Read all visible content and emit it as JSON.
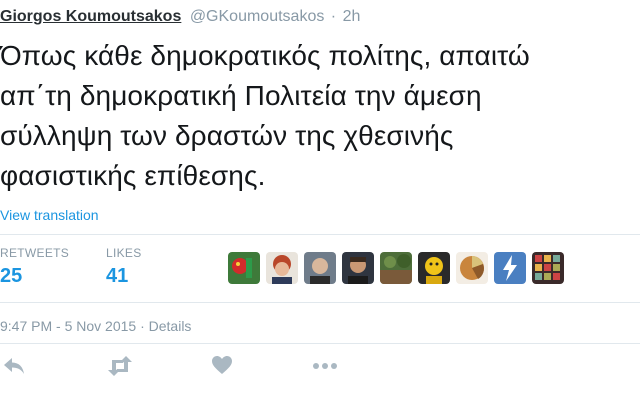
{
  "tweet": {
    "author_name": "Giorgos Koumoutsakos",
    "handle": "@GKoumoutsakos",
    "separator": "·",
    "age": "2h",
    "text_lines": [
      "Όπως κάθε δημοκρατικός πολίτης, απαιτώ",
      "απ΄τη δημοκρατική Πολιτεία την άμεση",
      "σύλληψη των δραστών της χθεσινής",
      "φασιστικής επίθεσης."
    ],
    "view_translation": "View translation",
    "stats": {
      "retweets_label": "RETWEETS",
      "retweets_count": "25",
      "likes_label": "LIKES",
      "likes_count": "41"
    },
    "timestamp": "9:47 PM - 5 Nov 2015",
    "details_link": "· Details"
  },
  "liker_avatars": [
    "parrot",
    "woman",
    "man-gray",
    "man-dark",
    "forest",
    "yellow-figure",
    "pie-chart",
    "bolt",
    "pattern"
  ],
  "icons": {
    "reply": "reply-icon",
    "retweet": "retweet-icon",
    "like": "heart-icon",
    "more": "more-icon"
  },
  "colors": {
    "link_blue": "#1b95e0",
    "muted_gray": "#8899a6",
    "text_dark": "#14171a",
    "icon_gray": "#aab8c2"
  }
}
